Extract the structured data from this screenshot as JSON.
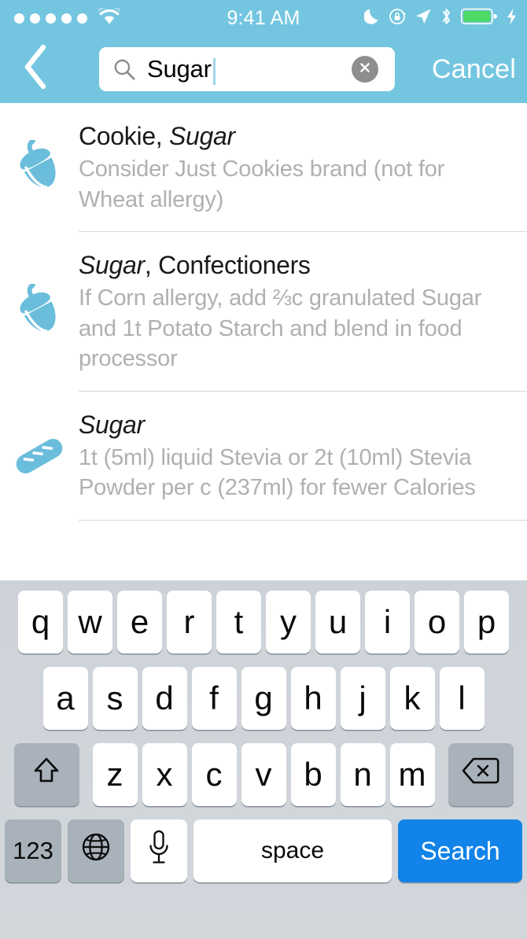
{
  "status_bar": {
    "signal_dots": 5,
    "wifi_icon": "wifi-icon",
    "time": "9:41 AM",
    "right_icons": [
      "moon-icon",
      "rotation-lock-icon",
      "location-arrow-icon",
      "bluetooth-icon",
      "battery-icon",
      "charging-bolt-icon"
    ],
    "battery_color": "#4cd964"
  },
  "nav_bar": {
    "back_icon": "chevron-left-icon",
    "search": {
      "icon": "search-icon",
      "value": "Sugar",
      "placeholder": "Search",
      "clear_icon": "clear-circle-icon"
    },
    "cancel_label": "Cancel"
  },
  "results": [
    {
      "icon": "acorn-icon",
      "title_prefix": "Cookie, ",
      "title_emphasis": "Sugar",
      "title_suffix": "",
      "subtitle": "Consider Just Cookies brand (not for Wheat allergy)"
    },
    {
      "icon": "acorn-icon",
      "title_prefix": "",
      "title_emphasis": "Sugar",
      "title_suffix": ", Confectioners",
      "subtitle": "If Corn allergy, add ⅔c granulated Sugar and 1t Potato Starch and blend in food processor"
    },
    {
      "icon": "bread-icon",
      "title_prefix": "",
      "title_emphasis": "Sugar",
      "title_suffix": "",
      "subtitle": "1t (5ml) liquid Stevia or 2t (10ml) Stevia Powder per c (237ml) for fewer Calories"
    }
  ],
  "keyboard": {
    "row1": [
      "q",
      "w",
      "e",
      "r",
      "t",
      "y",
      "u",
      "i",
      "o",
      "p"
    ],
    "row2": [
      "a",
      "s",
      "d",
      "f",
      "g",
      "h",
      "j",
      "k",
      "l"
    ],
    "row3": [
      "z",
      "x",
      "c",
      "v",
      "b",
      "n",
      "m"
    ],
    "shift_icon": "shift-arrow-icon",
    "delete_icon": "delete-backspace-icon",
    "numbers_label": "123",
    "globe_icon": "globe-icon",
    "mic_icon": "microphone-icon",
    "space_label": "space",
    "return_label": "Search",
    "return_color": "#1283e8"
  },
  "theme": {
    "header_blue": "#74c6e0",
    "icon_blue": "#6bbedb",
    "subtitle_gray": "#b0b0b0"
  }
}
